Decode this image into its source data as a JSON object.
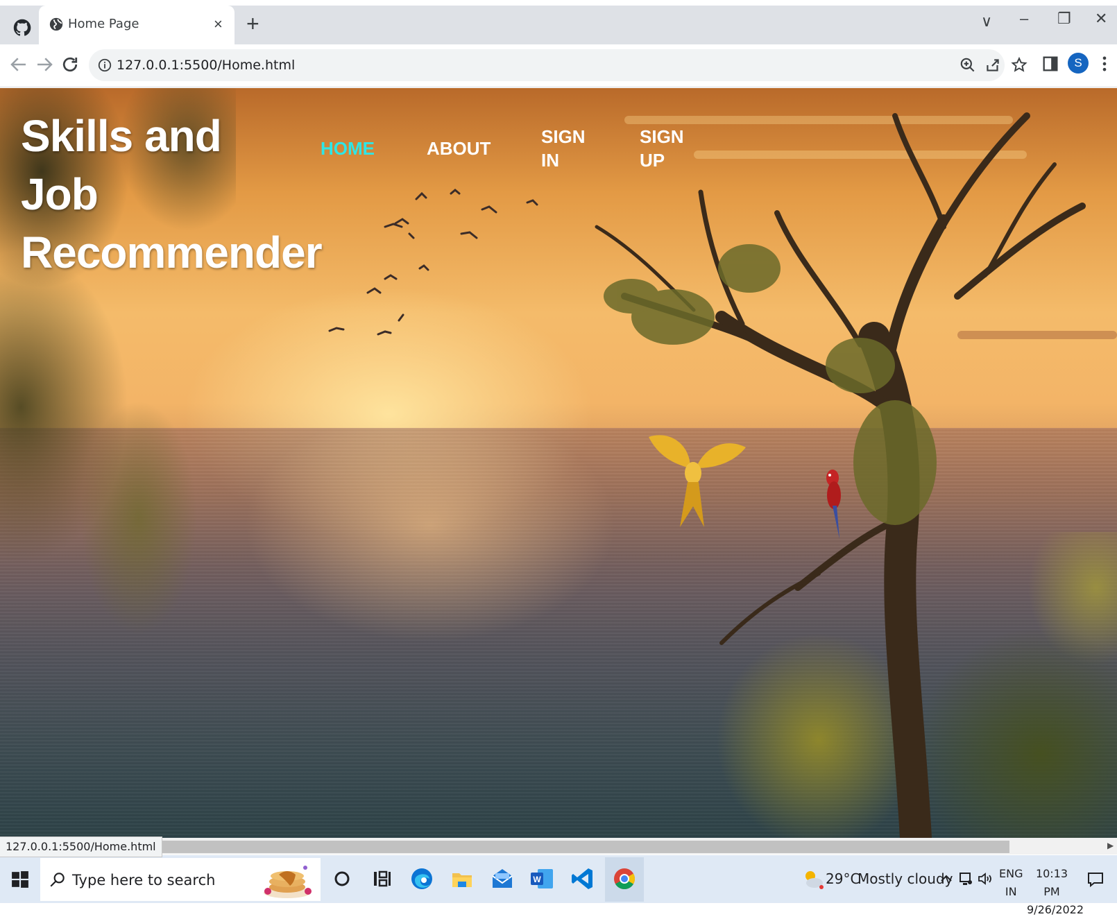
{
  "browser": {
    "tab_title": "Home Page",
    "tab_close": "×",
    "new_tab": "+",
    "address": "127.0.0.1:5500/Home.html",
    "profile_initial": "S",
    "window_controls": {
      "collapse": "∨",
      "minimize": "–",
      "restore": "❐",
      "close": "✕"
    }
  },
  "site": {
    "title_line1": "Skills and Job",
    "title_line2": "Recommender",
    "nav": {
      "home": "HOME",
      "about": "ABOUT",
      "signin_line1": "SIGN",
      "signin_line2": "IN",
      "signup_line1": "SIGN",
      "signup_line2": "UP"
    },
    "active_color": "#2ee6e6",
    "background": "sunset over sea with trees, flying birds and parrots"
  },
  "status_bar": {
    "hover_url": "127.0.0.1:5500/Home.html"
  },
  "taskbar": {
    "search_placeholder": "Type here to search",
    "apps": [
      "cortana-icon",
      "task-view-icon",
      "edge-icon",
      "file-explorer-icon",
      "mail-icon",
      "word-icon",
      "vscode-icon",
      "chrome-icon"
    ],
    "weather_temp": "29°C",
    "weather_condition": "Mostly cloudy",
    "language_line1": "ENG",
    "language_line2": "IN",
    "time": "10:13 PM",
    "date": "9/26/2022"
  }
}
